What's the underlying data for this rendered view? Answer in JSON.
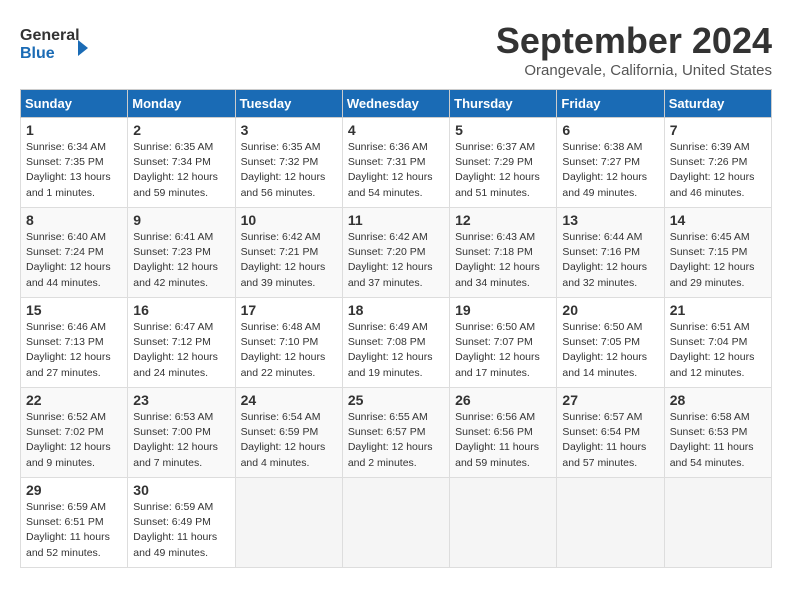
{
  "header": {
    "logo_line1": "General",
    "logo_line2": "Blue",
    "month_title": "September 2024",
    "location": "Orangevale, California, United States"
  },
  "weekdays": [
    "Sunday",
    "Monday",
    "Tuesday",
    "Wednesday",
    "Thursday",
    "Friday",
    "Saturday"
  ],
  "weeks": [
    [
      {
        "day": 1,
        "sunrise": "6:34 AM",
        "sunset": "7:35 PM",
        "daylight": "13 hours and 1 minute."
      },
      {
        "day": 2,
        "sunrise": "6:35 AM",
        "sunset": "7:34 PM",
        "daylight": "12 hours and 59 minutes."
      },
      {
        "day": 3,
        "sunrise": "6:35 AM",
        "sunset": "7:32 PM",
        "daylight": "12 hours and 56 minutes."
      },
      {
        "day": 4,
        "sunrise": "6:36 AM",
        "sunset": "7:31 PM",
        "daylight": "12 hours and 54 minutes."
      },
      {
        "day": 5,
        "sunrise": "6:37 AM",
        "sunset": "7:29 PM",
        "daylight": "12 hours and 51 minutes."
      },
      {
        "day": 6,
        "sunrise": "6:38 AM",
        "sunset": "7:27 PM",
        "daylight": "12 hours and 49 minutes."
      },
      {
        "day": 7,
        "sunrise": "6:39 AM",
        "sunset": "7:26 PM",
        "daylight": "12 hours and 46 minutes."
      }
    ],
    [
      {
        "day": 8,
        "sunrise": "6:40 AM",
        "sunset": "7:24 PM",
        "daylight": "12 hours and 44 minutes."
      },
      {
        "day": 9,
        "sunrise": "6:41 AM",
        "sunset": "7:23 PM",
        "daylight": "12 hours and 42 minutes."
      },
      {
        "day": 10,
        "sunrise": "6:42 AM",
        "sunset": "7:21 PM",
        "daylight": "12 hours and 39 minutes."
      },
      {
        "day": 11,
        "sunrise": "6:42 AM",
        "sunset": "7:20 PM",
        "daylight": "12 hours and 37 minutes."
      },
      {
        "day": 12,
        "sunrise": "6:43 AM",
        "sunset": "7:18 PM",
        "daylight": "12 hours and 34 minutes."
      },
      {
        "day": 13,
        "sunrise": "6:44 AM",
        "sunset": "7:16 PM",
        "daylight": "12 hours and 32 minutes."
      },
      {
        "day": 14,
        "sunrise": "6:45 AM",
        "sunset": "7:15 PM",
        "daylight": "12 hours and 29 minutes."
      }
    ],
    [
      {
        "day": 15,
        "sunrise": "6:46 AM",
        "sunset": "7:13 PM",
        "daylight": "12 hours and 27 minutes."
      },
      {
        "day": 16,
        "sunrise": "6:47 AM",
        "sunset": "7:12 PM",
        "daylight": "12 hours and 24 minutes."
      },
      {
        "day": 17,
        "sunrise": "6:48 AM",
        "sunset": "7:10 PM",
        "daylight": "12 hours and 22 minutes."
      },
      {
        "day": 18,
        "sunrise": "6:49 AM",
        "sunset": "7:08 PM",
        "daylight": "12 hours and 19 minutes."
      },
      {
        "day": 19,
        "sunrise": "6:50 AM",
        "sunset": "7:07 PM",
        "daylight": "12 hours and 17 minutes."
      },
      {
        "day": 20,
        "sunrise": "6:50 AM",
        "sunset": "7:05 PM",
        "daylight": "12 hours and 14 minutes."
      },
      {
        "day": 21,
        "sunrise": "6:51 AM",
        "sunset": "7:04 PM",
        "daylight": "12 hours and 12 minutes."
      }
    ],
    [
      {
        "day": 22,
        "sunrise": "6:52 AM",
        "sunset": "7:02 PM",
        "daylight": "12 hours and 9 minutes."
      },
      {
        "day": 23,
        "sunrise": "6:53 AM",
        "sunset": "7:00 PM",
        "daylight": "12 hours and 7 minutes."
      },
      {
        "day": 24,
        "sunrise": "6:54 AM",
        "sunset": "6:59 PM",
        "daylight": "12 hours and 4 minutes."
      },
      {
        "day": 25,
        "sunrise": "6:55 AM",
        "sunset": "6:57 PM",
        "daylight": "12 hours and 2 minutes."
      },
      {
        "day": 26,
        "sunrise": "6:56 AM",
        "sunset": "6:56 PM",
        "daylight": "11 hours and 59 minutes."
      },
      {
        "day": 27,
        "sunrise": "6:57 AM",
        "sunset": "6:54 PM",
        "daylight": "11 hours and 57 minutes."
      },
      {
        "day": 28,
        "sunrise": "6:58 AM",
        "sunset": "6:53 PM",
        "daylight": "11 hours and 54 minutes."
      }
    ],
    [
      {
        "day": 29,
        "sunrise": "6:59 AM",
        "sunset": "6:51 PM",
        "daylight": "11 hours and 52 minutes."
      },
      {
        "day": 30,
        "sunrise": "6:59 AM",
        "sunset": "6:49 PM",
        "daylight": "11 hours and 49 minutes."
      },
      null,
      null,
      null,
      null,
      null
    ]
  ]
}
